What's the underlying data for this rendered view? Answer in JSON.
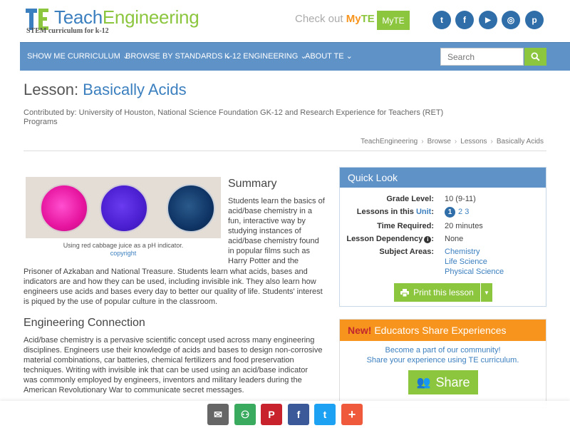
{
  "header": {
    "logo_teach": "Teach",
    "logo_engineering": "Engineering",
    "tagline": "STEM curriculum for k-12",
    "checkout_text": "Check out",
    "myte_my": "My",
    "myte_te": "TE",
    "myte_button": "MyTE",
    "social": [
      {
        "icon": "twitter-icon",
        "glyph": "t"
      },
      {
        "icon": "facebook-icon",
        "glyph": "f"
      },
      {
        "icon": "youtube-icon",
        "glyph": "▶"
      },
      {
        "icon": "instagram-icon",
        "glyph": "◎"
      },
      {
        "icon": "pinterest-icon",
        "glyph": "p"
      }
    ]
  },
  "nav": {
    "items": [
      {
        "label": "SHOW ME CURRICULUM"
      },
      {
        "label": "BROWSE BY STANDARDS"
      },
      {
        "label": "K-12 ENGINEERING"
      },
      {
        "label": "ABOUT TE"
      }
    ],
    "search_placeholder": "Search"
  },
  "lesson": {
    "prefix": "Lesson: ",
    "title": "Basically Acids",
    "contributed": "Contributed by: University of Houston, National Science Foundation GK-12 and Research Experience for Teachers (RET) Programs"
  },
  "breadcrumb": [
    "TeachEngineering",
    "Browse",
    "Lessons",
    "Basically Acids"
  ],
  "image": {
    "caption": "Using red cabbage juice as a pH indicator.",
    "copyright": "copyright"
  },
  "summary": {
    "heading": "Summary",
    "text_narrow": "Students learn the basics of acid/base chemistry in a fun, interactive way by studying instances of acid/base chemistry found in popular films such as Harry Potter and the",
    "text_wide": "Prisoner of Azkaban and National Treasure. Students learn what acids, bases and indicators are and how they can be used, including invisible ink. They also learn how engineers use acids and bases every day to better our quality of life. Students' interest is piqued by the use of popular culture in the classroom."
  },
  "engineering": {
    "heading": "Engineering Connection",
    "text": "Acid/base chemistry is a pervasive scientific concept used across many engineering disciplines. Engineers use their knowledge of acids and bases to design non-corrosive material combinations, car batteries, chemical fertilizers and food preservation techniques. Writing with invisible ink that can be used using an acid/base indicator was commonly employed by engineers, inventors and military leaders during the American Revolutionary War to communicate secret messages."
  },
  "quick_look": {
    "heading": "Quick Look",
    "grade_label": "Grade Level:",
    "grade_value": "10 (9-11)",
    "unit_label_pre": "Lessons in this ",
    "unit_label_link": "Unit",
    "unit_label_post": ":",
    "unit_pages": [
      "1",
      "2",
      "3"
    ],
    "time_label": "Time Required:",
    "time_value": "20 minutes",
    "dependency_label": "Lesson Dependency",
    "dependency_value": "None",
    "subjects_label": "Subject Areas:",
    "subjects": [
      "Chemistry",
      "Life Science",
      "Physical Science"
    ],
    "print_label": "Print this lesson"
  },
  "educators": {
    "new": "New!",
    "heading": " Educators Share Experiences",
    "line1": "Become a part of our community!",
    "line2": "Share your experience using TE curriculum.",
    "share_label": "Share"
  },
  "share_bar": [
    {
      "icon": "email-icon",
      "glyph": "✉",
      "color": "#666666"
    },
    {
      "icon": "share-community-icon",
      "glyph": "⚇",
      "color": "#3aaa5f"
    },
    {
      "icon": "pinterest-icon",
      "glyph": "P",
      "color": "#c8232c"
    },
    {
      "icon": "facebook-icon",
      "glyph": "f",
      "color": "#3b5998"
    },
    {
      "icon": "twitter-icon",
      "glyph": "t",
      "color": "#1da1f2"
    },
    {
      "icon": "more-icon",
      "glyph": "+",
      "color": "#f05a3c"
    }
  ],
  "colors": {
    "brand_blue": "#3b7fbf",
    "brand_green": "#8cc63f",
    "nav_blue": "#5f92c7",
    "orange": "#f7941d"
  }
}
